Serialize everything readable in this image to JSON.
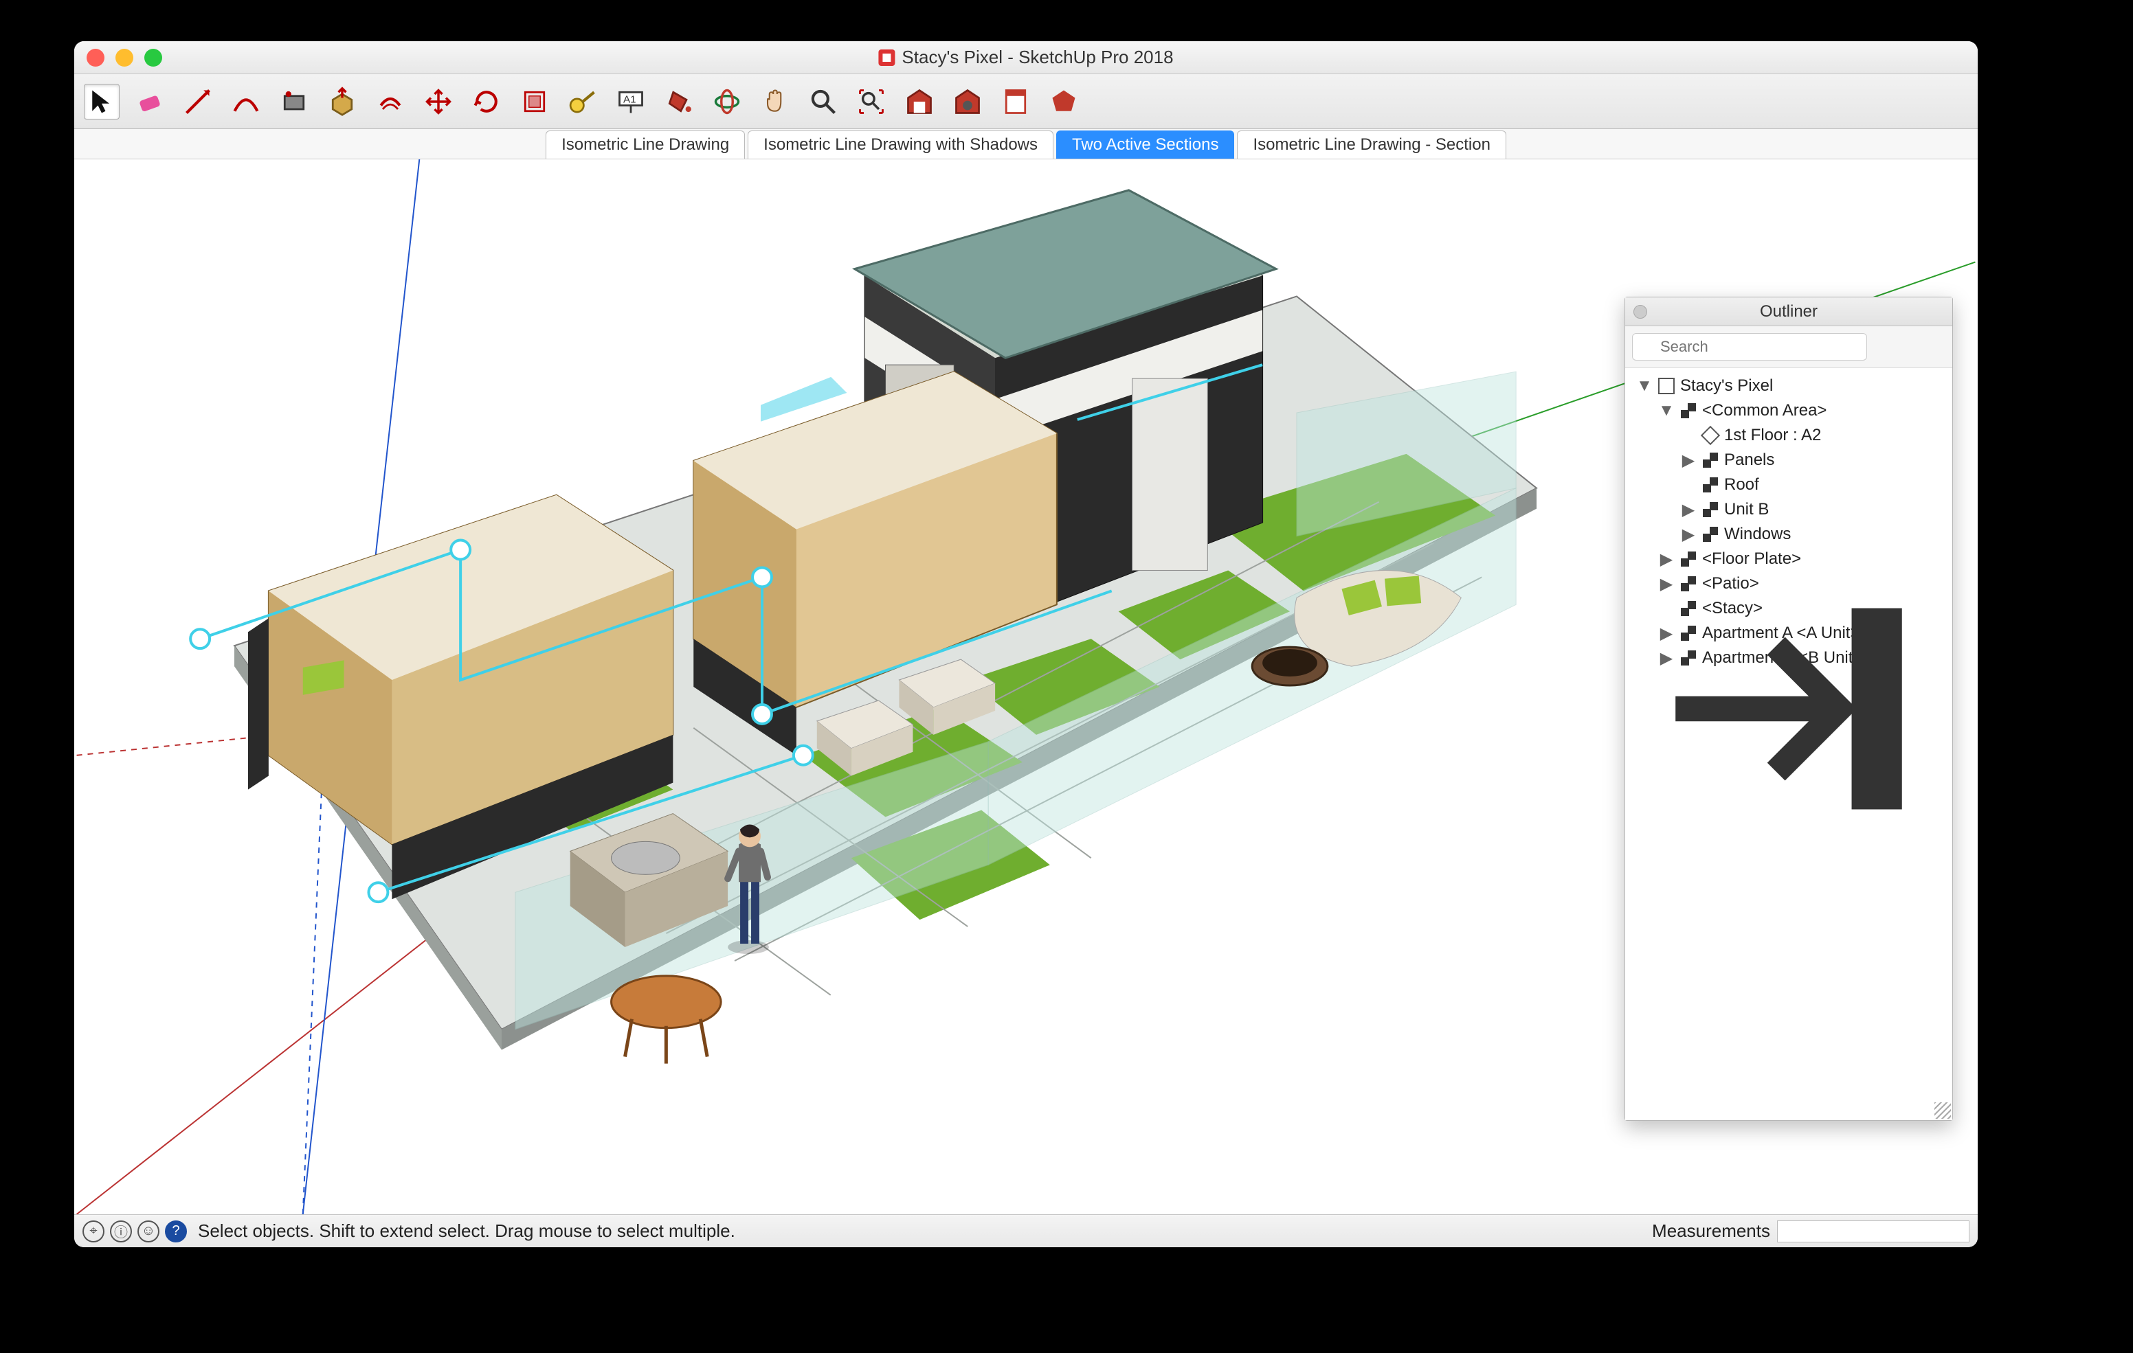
{
  "window": {
    "title": "Stacy's Pixel - SketchUp Pro 2018"
  },
  "toolbar": {
    "tools": [
      {
        "name": "select-tool",
        "active": true
      },
      {
        "name": "eraser-tool"
      },
      {
        "name": "line-tool"
      },
      {
        "name": "arc-tool"
      },
      {
        "name": "shapes-tool"
      },
      {
        "name": "pushpull-tool"
      },
      {
        "name": "offset-tool"
      },
      {
        "name": "move-tool"
      },
      {
        "name": "rotate-tool"
      },
      {
        "name": "scale-tool"
      },
      {
        "name": "tape-measure-tool"
      },
      {
        "name": "text-tool"
      },
      {
        "name": "paint-bucket-tool"
      },
      {
        "name": "orbit-tool"
      },
      {
        "name": "pan-tool"
      },
      {
        "name": "zoom-tool"
      },
      {
        "name": "zoom-extents-tool"
      },
      {
        "name": "3d-warehouse-tool"
      },
      {
        "name": "extension-warehouse-tool"
      },
      {
        "name": "layout-tool"
      },
      {
        "name": "extensions-tool"
      }
    ]
  },
  "scenes": [
    {
      "label": "Isometric Line Drawing",
      "active": false
    },
    {
      "label": "Isometric Line Drawing with Shadows",
      "active": false
    },
    {
      "label": "Two Active Sections",
      "active": true
    },
    {
      "label": "Isometric Line Drawing - Section",
      "active": false
    }
  ],
  "outliner": {
    "title": "Outliner",
    "search_placeholder": "Search",
    "tree": [
      {
        "depth": 0,
        "arrow": "down",
        "icon": "home",
        "label": "Stacy's Pixel"
      },
      {
        "depth": 1,
        "arrow": "down",
        "icon": "group",
        "label": "<Common Area>"
      },
      {
        "depth": 2,
        "arrow": "",
        "icon": "section",
        "label": "1st Floor : A2"
      },
      {
        "depth": 2,
        "arrow": "right",
        "icon": "group",
        "label": "Panels"
      },
      {
        "depth": 2,
        "arrow": "",
        "icon": "group",
        "label": "Roof"
      },
      {
        "depth": 2,
        "arrow": "right",
        "icon": "group",
        "label": "Unit B"
      },
      {
        "depth": 2,
        "arrow": "right",
        "icon": "group",
        "label": "Windows"
      },
      {
        "depth": 1,
        "arrow": "right",
        "icon": "group",
        "label": "<Floor Plate>"
      },
      {
        "depth": 1,
        "arrow": "right",
        "icon": "group",
        "label": "<Patio>"
      },
      {
        "depth": 1,
        "arrow": "",
        "icon": "group",
        "label": "<Stacy>"
      },
      {
        "depth": 1,
        "arrow": "right",
        "icon": "group",
        "label": "Apartment A <A Unit>"
      },
      {
        "depth": 1,
        "arrow": "right",
        "icon": "group",
        "label": "Apartment B <B Unit>"
      }
    ]
  },
  "statusbar": {
    "hint": "Select objects. Shift to extend select. Drag mouse to select multiple.",
    "measurements_label": "Measurements",
    "measurements_value": ""
  }
}
